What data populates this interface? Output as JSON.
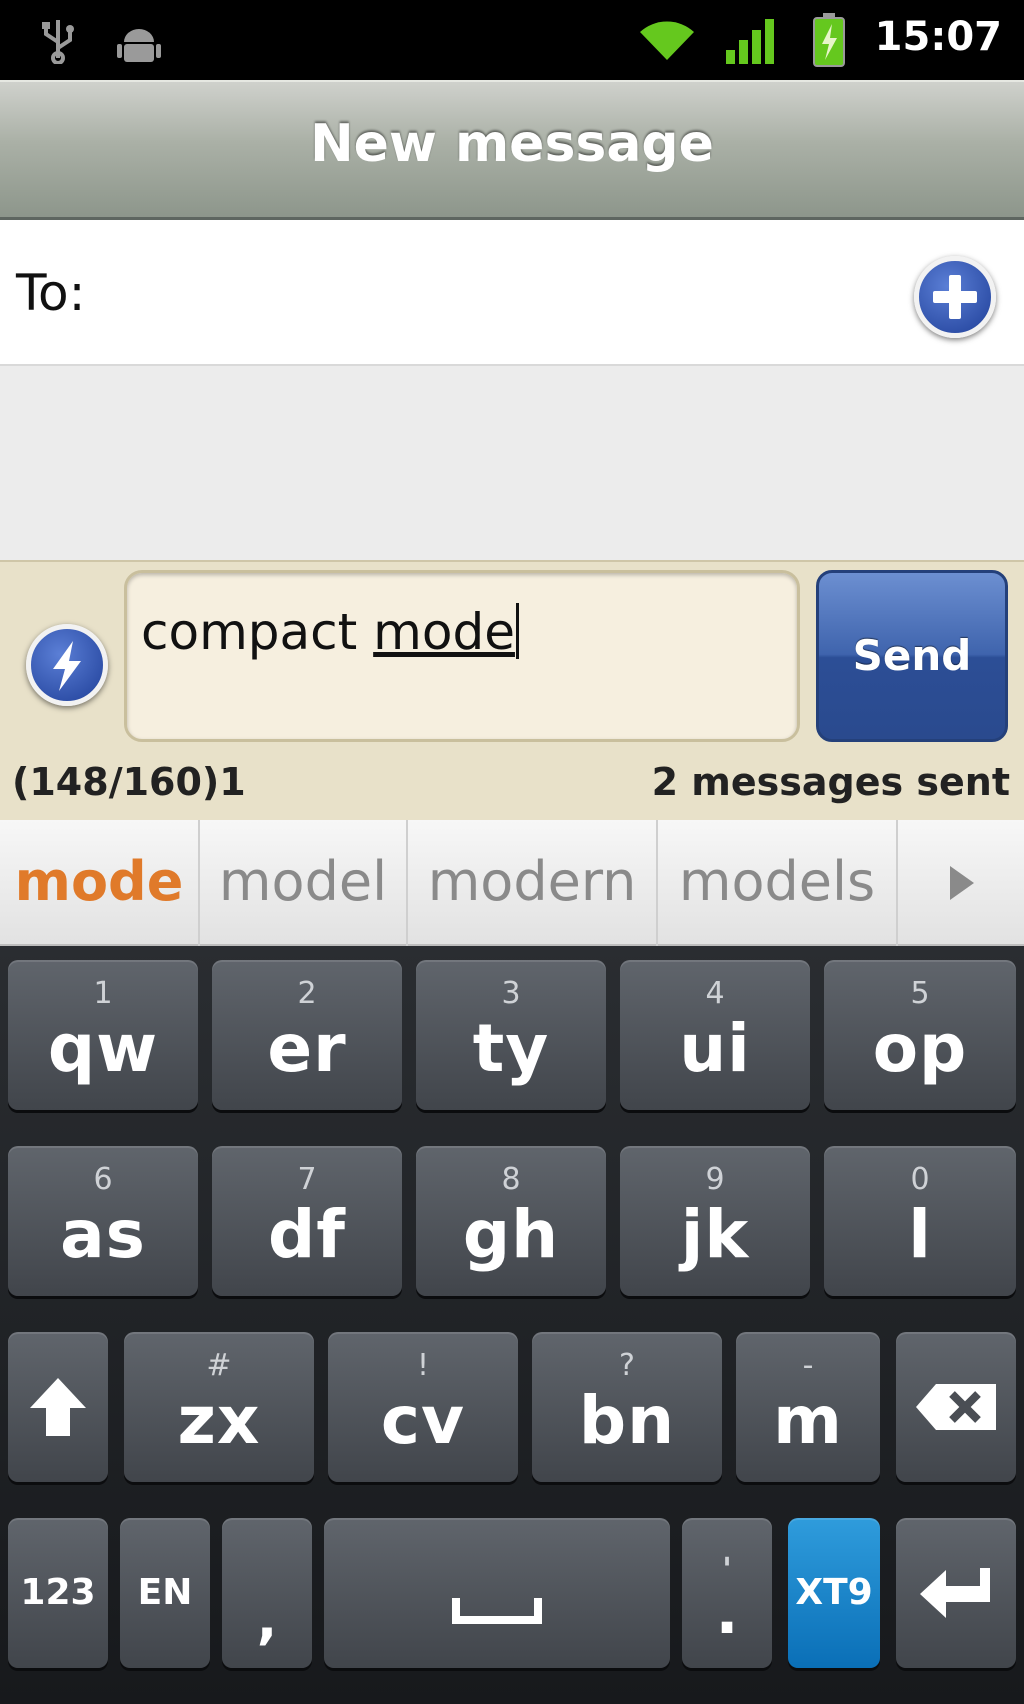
{
  "status_bar": {
    "time": "15:07",
    "icons": [
      "usb-icon",
      "android-debug-icon",
      "wifi-icon",
      "signal-icon",
      "battery-charging-icon"
    ]
  },
  "title_bar": {
    "title": "New message"
  },
  "recipient": {
    "label": "To:",
    "value": "",
    "add_icon": "plus-circle-icon"
  },
  "compose": {
    "text_prefix": "compact ",
    "text_composing": "mode",
    "send_label": "Send",
    "char_counter": "(148/160)1",
    "status": "2 messages sent",
    "quick_icon": "lightning-icon"
  },
  "suggestions": {
    "items": [
      "mode",
      "model",
      "modern",
      "models"
    ],
    "more_icon": "arrow-right-icon"
  },
  "keyboard": {
    "row1": [
      {
        "num": "1",
        "label": "qw"
      },
      {
        "num": "2",
        "label": "er"
      },
      {
        "num": "3",
        "label": "ty"
      },
      {
        "num": "4",
        "label": "ui"
      },
      {
        "num": "5",
        "label": "op"
      }
    ],
    "row2": [
      {
        "num": "6",
        "label": "as"
      },
      {
        "num": "7",
        "label": "df"
      },
      {
        "num": "8",
        "label": "gh"
      },
      {
        "num": "9",
        "label": "jk"
      },
      {
        "num": "0",
        "label": "l"
      }
    ],
    "row3": [
      {
        "num": "#",
        "label": "zx"
      },
      {
        "num": "!",
        "label": "cv"
      },
      {
        "num": "?",
        "label": "bn"
      },
      {
        "num": "-",
        "label": "m"
      }
    ],
    "row4": {
      "numbers": "123",
      "language": "EN",
      "comma": ",",
      "period_top": "'",
      "period": ".",
      "xt9": "XT9"
    },
    "accent_color": "#1e88d0"
  }
}
